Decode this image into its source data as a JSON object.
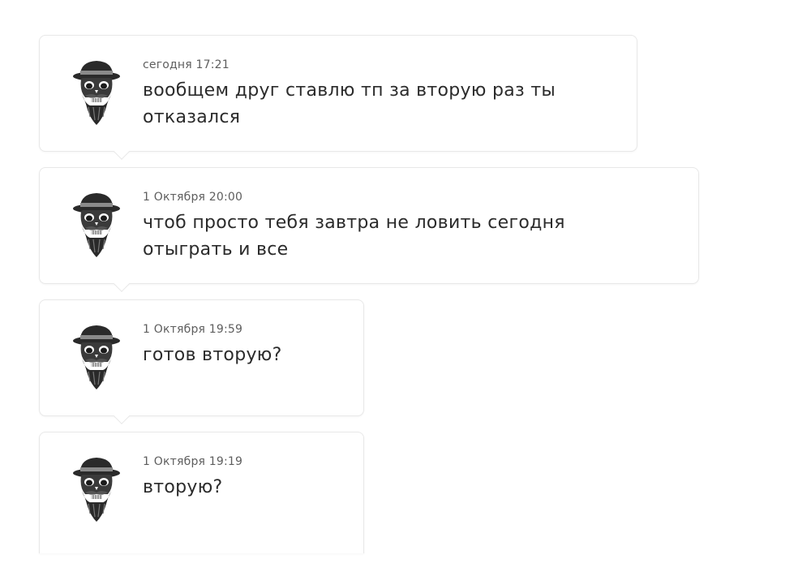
{
  "messages": [
    {
      "time": "сегодня 17:21",
      "text": "вообщем друг ставлю тп за вторую раз ты отказался",
      "avatar_icon": "skull-hat-beard-avatar-icon"
    },
    {
      "time": "1 Октября 20:00",
      "text": "чтоб просто тебя завтра не ловить сегодня отыграть и все",
      "avatar_icon": "skull-hat-beard-avatar-icon"
    },
    {
      "time": "1 Октября 19:59",
      "text": "готов вторую?",
      "avatar_icon": "skull-hat-beard-avatar-icon"
    },
    {
      "time": "1 Октября 19:19",
      "text": "вторую?",
      "avatar_icon": "skull-hat-beard-avatar-icon"
    }
  ],
  "colors": {
    "card_border": "#e8e8e8",
    "meta_text": "#5e5e5e",
    "body_text": "#2b2b2b",
    "avatar": "#2a2a2a"
  }
}
